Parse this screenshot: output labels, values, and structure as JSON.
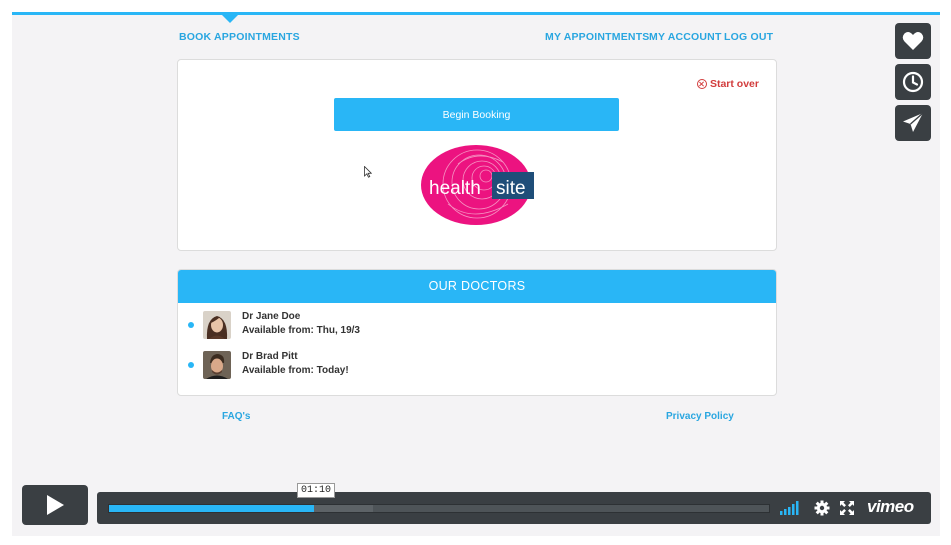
{
  "nav": {
    "book_appointments": "BOOK APPOINTMENTS",
    "my_appointments": "MY APPOINTMENTS",
    "my_account": "MY ACCOUNT",
    "log_out": "LOG OUT"
  },
  "booking": {
    "start_over": "Start over",
    "begin_booking": "Begin Booking",
    "logo_word1": "health",
    "logo_word2": "site"
  },
  "doctors": {
    "header": "OUR DOCTORS",
    "items": [
      {
        "name": "Dr Jane Doe",
        "available": "Available from: Thu, 19/3"
      },
      {
        "name": "Dr Brad Pitt",
        "available": "Available from: Today!"
      }
    ]
  },
  "footer": {
    "faq": "FAQ's",
    "privacy": "Privacy Policy"
  },
  "player": {
    "time_tooltip": "01:10",
    "brand": "vimeo",
    "progress_played": 0.31,
    "progress_buffered": 0.4
  },
  "colors": {
    "accent": "#29b6f6",
    "danger": "#d23c3c",
    "logo_pink": "#ec1380",
    "logo_blue": "#1f4e79",
    "player_bg": "#3a3f43"
  },
  "icons": {
    "side": [
      "heart-icon",
      "clock-icon",
      "send-icon"
    ],
    "player": [
      "play-icon",
      "volume-icon",
      "settings-icon",
      "fullscreen-icon"
    ]
  }
}
